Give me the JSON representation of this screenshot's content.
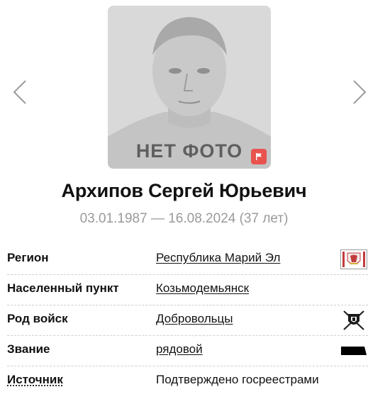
{
  "photo": {
    "placeholder_label": "НЕТ ФОТО",
    "flag_color": "#e8524f"
  },
  "person": {
    "full_name": "Архипов Сергей Юрьевич",
    "dates": "03.01.1987 — 16.08.2024 (37 лет)"
  },
  "details": {
    "region": {
      "label": "Регион",
      "value": "Республика Марий Эл",
      "icon": "region-coat-of-arms-icon"
    },
    "settlement": {
      "label": "Населенный пункт",
      "value": "Козьмодемьянск"
    },
    "branch": {
      "label": "Род войск",
      "value": "Добровольцы",
      "icon": "volunteers-emblem-icon"
    },
    "rank": {
      "label": "Звание",
      "value": "рядовой",
      "icon": "rank-insignia-icon"
    },
    "source": {
      "label": "Источник",
      "value": "Подтверждено госреестрами"
    }
  },
  "colors": {
    "accent_red": "#e8524f",
    "muted_text": "#9a9a9a",
    "arrow": "#9a9a9a"
  }
}
